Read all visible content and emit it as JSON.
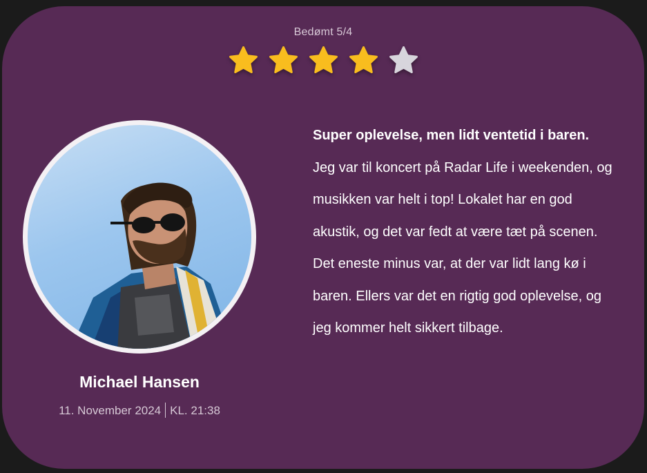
{
  "rating": {
    "label": "Bedømt 5/4",
    "stars": [
      {
        "filled": true
      },
      {
        "filled": true
      },
      {
        "filled": true
      },
      {
        "filled": true
      },
      {
        "filled": false
      }
    ],
    "star_filled_color": "#f9bd1e",
    "star_empty_color": "#d7d5dc"
  },
  "reviewer": {
    "name": "Michael Hansen",
    "date": "11. November 2024",
    "time": "KL. 21:38"
  },
  "review": {
    "title": "Super oplevelse, men lidt ventetid i baren.",
    "body": "Jeg var til koncert på Radar Life i weekenden, og musikken var helt i top! Lokalet har en god akustik, og det var fedt at være tæt på scenen. Det eneste minus var, at der var lidt lang kø i baren. Ellers var det en rigtig god oplevelse, og jeg kommer helt sikkert tilbage."
  },
  "colors": {
    "card_background": "#572a55",
    "page_background": "#1b1b1b"
  }
}
